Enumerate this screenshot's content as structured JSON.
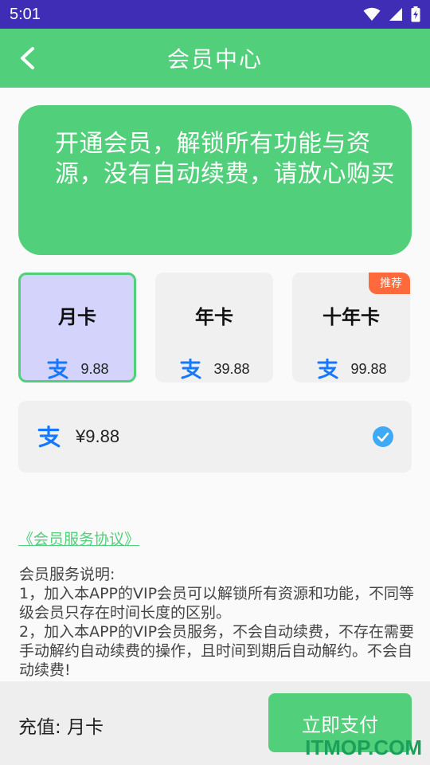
{
  "status_bar": {
    "time": "5:01"
  },
  "header": {
    "title": "会员中心"
  },
  "banner": {
    "text": "开通会员，解锁所有功能与资\n源，没有自动续费，请放心购买"
  },
  "plans": [
    {
      "name": "月卡",
      "price": "9.88",
      "selected": true
    },
    {
      "name": "年卡",
      "price": "39.88",
      "selected": false
    },
    {
      "name": "十年卡",
      "price": "99.88",
      "selected": false,
      "badge": "推荐"
    }
  ],
  "payment": {
    "amount": "¥9.88",
    "method_icon": "alipay-icon"
  },
  "agreement": {
    "label": "《会员服务协议》"
  },
  "description": {
    "title": "会员服务说明:",
    "line1": "1，加入本APP的VIP会员可以解锁所有资源和功能，不同等级会员只存在时间长度的区别。",
    "line2": "2，加入本APP的VIP会员服务，不会自动续费，不存在需要手动解约自动续费的操作，且时间到期后自动解约。不会自动续费!"
  },
  "footer": {
    "charge_label": "充值: 月卡",
    "pay_button": "立即支付",
    "watermark": "ITMOP.COM"
  },
  "colors": {
    "accent": "#52cf7b",
    "status_bar": "#3f2eb5",
    "selected_card": "#d4d3fb",
    "badge": "#ff6a3d",
    "alipay": "#1677ff",
    "check": "#3fa9f5"
  }
}
